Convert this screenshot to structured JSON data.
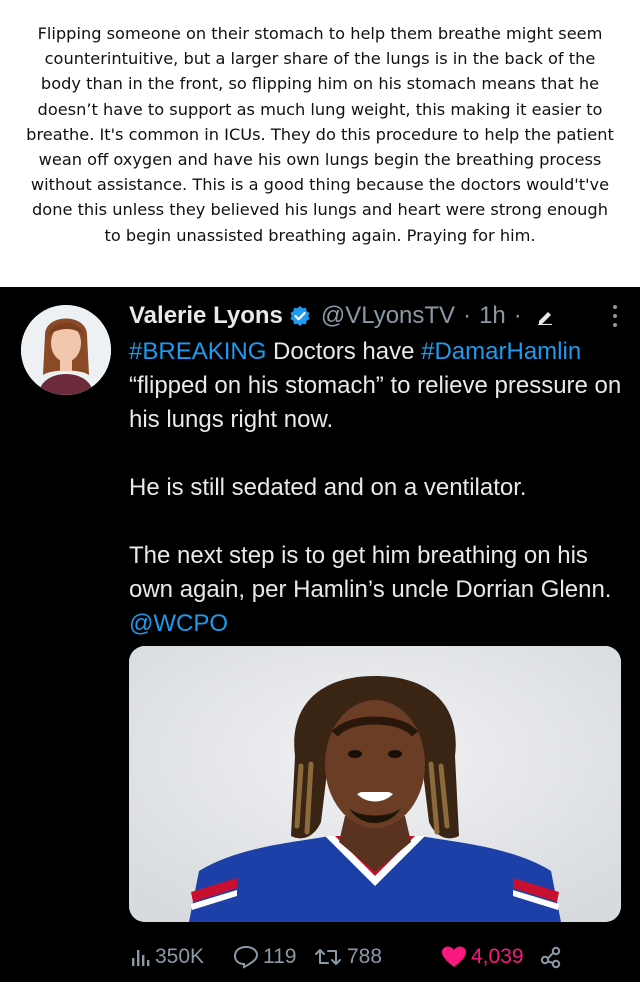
{
  "caption": {
    "text": "Flipping someone on their stomach to help them breathe might seem counterintuitive, but a larger share of the lungs is in the back of the body than in the front, so flipping him on his stomach means that he doesn’t have to support as much lung weight, this making it easier to breathe. It's common in ICUs. They do this procedure to help the patient wean off oxygen and have his own lungs begin the breathing process without assistance. This is a good thing because the doctors would't've done this unless they believed his lungs and heart were strong enough to begin unassisted breathing again. Praying for him."
  },
  "tweet": {
    "author_name": "Valerie Lyons",
    "handle": "@VLyonsTV",
    "separator": "·",
    "time": "1h",
    "line1_tag": "#BREAKING",
    "line1_text": " Doctors have ",
    "line1_tag2": "#DamarHamlin",
    "line1_rest": " “flipped on his stomach” to relieve pressure on his lungs right now.",
    "paragraph2": "He is still sedated and on a ventilator.",
    "paragraph3": "The next step is to get him breathing on his own again, per Hamlin’s uncle Dorrian Glenn. ",
    "paragraph3_mention": "@WCPO",
    "icons": {
      "verified": "verified-badge-icon",
      "edit": "edited-pencil-icon",
      "more": "more-options-icon"
    }
  },
  "actions": {
    "views": "350K",
    "replies": "119",
    "retweets": "788",
    "likes": "4,039"
  },
  "colors": {
    "accent": "#1d9bf0",
    "like": "#f91880",
    "muted": "#8b98a5",
    "text": "#e7e9ea"
  }
}
